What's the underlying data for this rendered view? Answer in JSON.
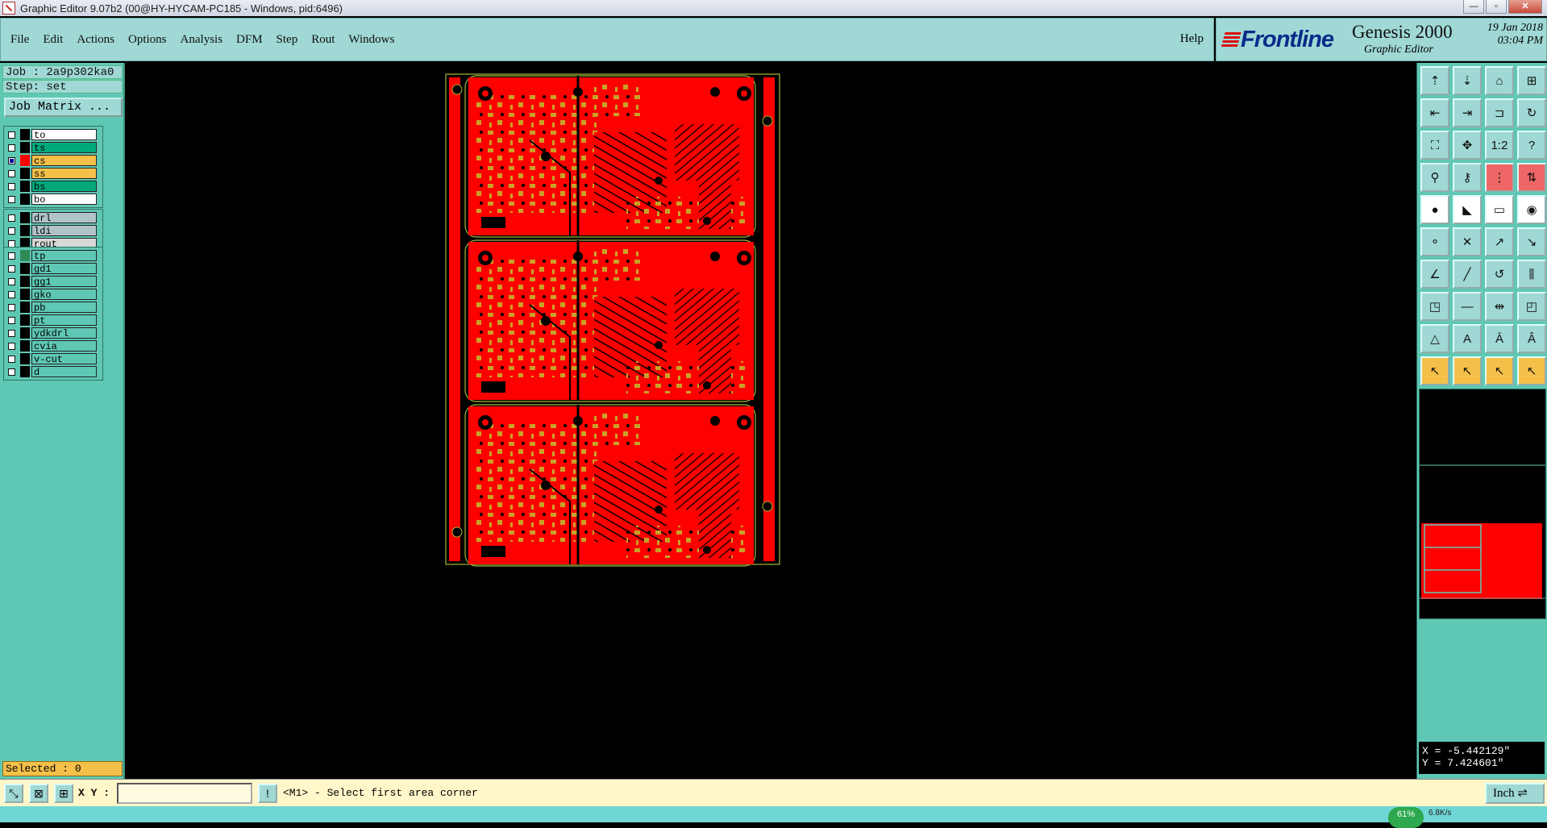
{
  "window": {
    "title": "Graphic Editor 9.07b2 (00@HY-HYCAM-PC185 - Windows, pid:6496)",
    "minimize": "—",
    "maximize": "▫",
    "close": "✕"
  },
  "menu": {
    "items": [
      "File",
      "Edit",
      "Actions",
      "Options",
      "Analysis",
      "DFM",
      "Step",
      "Rout",
      "Windows"
    ],
    "help": "Help"
  },
  "brand": {
    "logo": "Frontline",
    "product": "Genesis 2000",
    "subtitle": "Graphic Editor",
    "date": "19 Jan 2018",
    "time": "03:04 PM"
  },
  "job": {
    "job_line": "Job : 2a9p302ka0",
    "step_line": "Step: set",
    "matrix_button": "Job Matrix ..."
  },
  "layers": {
    "group1": [
      {
        "name": "to",
        "color": "#ffffff",
        "checked": false
      },
      {
        "name": "ts",
        "color": "#00a87a",
        "checked": false
      },
      {
        "name": "cs",
        "color": "#f5c04a",
        "checked": true,
        "swatch": "#ff0000"
      },
      {
        "name": "ss",
        "color": "#f5c04a",
        "checked": false
      },
      {
        "name": "bs",
        "color": "#00a87a",
        "checked": false
      },
      {
        "name": "bo",
        "color": "#ffffff",
        "checked": false
      }
    ],
    "group2": [
      {
        "name": "drl",
        "color": "#b0c4c8",
        "checked": false
      },
      {
        "name": "ldi",
        "color": "#b0c4c8",
        "checked": false
      },
      {
        "name": "rout",
        "color": "#d8d8d8",
        "checked": false
      }
    ],
    "group3": [
      {
        "name": "tp",
        "color": "#5fc8b4",
        "checked": false,
        "swatch": "#2e8b57"
      },
      {
        "name": "gd1",
        "color": "#5fc8b4",
        "checked": false
      },
      {
        "name": "gg1",
        "color": "#5fc8b4",
        "checked": false
      },
      {
        "name": "gko",
        "color": "#5fc8b4",
        "checked": false
      },
      {
        "name": "pb",
        "color": "#5fc8b4",
        "checked": false
      },
      {
        "name": "pt",
        "color": "#5fc8b4",
        "checked": false
      },
      {
        "name": "ydkdrl",
        "color": "#5fc8b4",
        "checked": false
      },
      {
        "name": "cvia",
        "color": "#5fc8b4",
        "checked": false
      },
      {
        "name": "v-cut",
        "color": "#5fc8b4",
        "checked": false
      },
      {
        "name": "d",
        "color": "#5fc8b4",
        "checked": false
      }
    ]
  },
  "selected": "Selected : 0",
  "toolbar": {
    "buttons": [
      {
        "icon": "layer-up-icon",
        "glyph": "⇡",
        "style": ""
      },
      {
        "icon": "layer-down-icon",
        "glyph": "⇣",
        "style": ""
      },
      {
        "icon": "home-icon",
        "glyph": "⌂",
        "style": ""
      },
      {
        "icon": "window-icon",
        "glyph": "⊞",
        "style": ""
      },
      {
        "icon": "zoom-left-icon",
        "glyph": "⇤",
        "style": ""
      },
      {
        "icon": "zoom-right-icon",
        "glyph": "⇥",
        "style": ""
      },
      {
        "icon": "pan-icon",
        "glyph": "⊐",
        "style": ""
      },
      {
        "icon": "redraw-icon",
        "glyph": "↻",
        "style": ""
      },
      {
        "icon": "fit-icon",
        "glyph": "⛶",
        "style": ""
      },
      {
        "icon": "center-icon",
        "glyph": "✥",
        "style": ""
      },
      {
        "icon": "scale-1-2-icon",
        "glyph": "1:2",
        "style": ""
      },
      {
        "icon": "query-icon",
        "glyph": "?",
        "style": ""
      },
      {
        "icon": "snap-icon",
        "glyph": "⚲",
        "style": ""
      },
      {
        "icon": "key-icon",
        "glyph": "⚷",
        "style": ""
      },
      {
        "icon": "traffic-icon",
        "glyph": "⋮",
        "style": "red"
      },
      {
        "icon": "traffic-arrow-icon",
        "glyph": "⇅",
        "style": "red"
      },
      {
        "icon": "pad-icon",
        "glyph": "●",
        "style": "white"
      },
      {
        "icon": "line-icon",
        "glyph": "◣",
        "style": "white"
      },
      {
        "icon": "ruler-icon",
        "glyph": "▭",
        "style": "white"
      },
      {
        "icon": "circle-icon",
        "glyph": "◉",
        "style": "white"
      },
      {
        "icon": "connect-icon",
        "glyph": "⚬",
        "style": ""
      },
      {
        "icon": "cross-icon",
        "glyph": "✕",
        "style": ""
      },
      {
        "icon": "add-node-icon",
        "glyph": "↗",
        "style": ""
      },
      {
        "icon": "arc-node-icon",
        "glyph": "↘",
        "style": ""
      },
      {
        "icon": "angle-icon",
        "glyph": "∠",
        "style": ""
      },
      {
        "icon": "slash-icon",
        "glyph": "╱",
        "style": ""
      },
      {
        "icon": "curve-icon",
        "glyph": "↺",
        "style": ""
      },
      {
        "icon": "comb-icon",
        "glyph": "⫼",
        "style": ""
      },
      {
        "icon": "move-pad-icon",
        "glyph": "◳",
        "style": ""
      },
      {
        "icon": "hline-icon",
        "glyph": "—",
        "style": ""
      },
      {
        "icon": "measure-icon",
        "glyph": "⇹",
        "style": ""
      },
      {
        "icon": "copy-pad-icon",
        "glyph": "◰",
        "style": ""
      },
      {
        "icon": "triangle-icon",
        "glyph": "△",
        "style": ""
      },
      {
        "icon": "text-a-icon",
        "glyph": "A",
        "style": ""
      },
      {
        "icon": "text-a-box-icon",
        "glyph": "Ā",
        "style": ""
      },
      {
        "icon": "text-a-line-icon",
        "glyph": "Â",
        "style": ""
      },
      {
        "icon": "pointer-icon",
        "glyph": "↖",
        "style": "yel"
      },
      {
        "icon": "select-pointer-icon",
        "glyph": "↖",
        "style": "yel"
      },
      {
        "icon": "area-pointer-icon",
        "glyph": "↖",
        "style": "yel"
      },
      {
        "icon": "route-pointer-icon",
        "glyph": "↖",
        "style": "yel"
      }
    ]
  },
  "coords": {
    "x": "X = -5.442129\"",
    "y": "Y = 7.424601\""
  },
  "status": {
    "xy_label": "X Y :",
    "xy_value": "",
    "message": "<M1> - Select first area corner",
    "unit": "Inch ⇌"
  },
  "taskbar": {
    "cpu": "61%",
    "net": "6.8K/s"
  },
  "colors": {
    "panel": "#5fc8b4",
    "menu": "#9fd8d4",
    "board": "#ff0000",
    "pads": "#c9a227",
    "outline": "#9fb83a"
  }
}
